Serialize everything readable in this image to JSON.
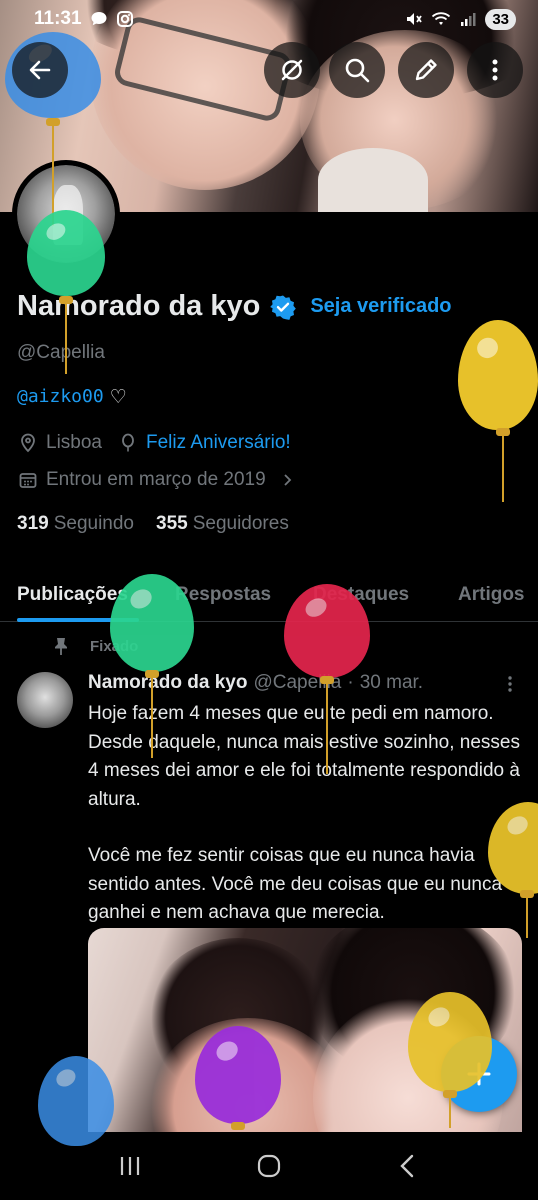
{
  "status_bar": {
    "time": "11:31",
    "battery": "33"
  },
  "header": {
    "icons": [
      "back-arrow-icon",
      "notification-off-icon",
      "search-icon",
      "edit-icon",
      "more-vertical-icon"
    ]
  },
  "profile": {
    "display_name": "Namorado da kyo",
    "get_verified_label": "Seja verificado",
    "handle": "@Capellia",
    "bio_mention": "@aizko00",
    "bio_suffix": "♡",
    "location": "Lisboa",
    "birthday": "Feliz Aniversário!",
    "joined": "Entrou em março de 2019",
    "following_count": "319",
    "following_label": "Seguindo",
    "followers_count": "355",
    "followers_label": "Seguidores"
  },
  "tabs": [
    {
      "label": "Publicações",
      "active": true
    },
    {
      "label": "Respostas",
      "active": false
    },
    {
      "label": "Destaques",
      "active": false
    },
    {
      "label": "Artigos",
      "active": false
    }
  ],
  "pinned_tweet": {
    "pinned_label": "Fixado",
    "author_name": "Namorado da kyo",
    "author_handle": "@Capellia",
    "separator": "·",
    "date": "30 mar.",
    "paragraph_1": "Hoje fazem 4 meses que eu te pedi em namoro. Desde daquele, nunca mais estive sozinho, nesses 4 meses dei amor e ele foi totalmente respondido à altura.",
    "paragraph_2": "Você me fez sentir coisas que eu nunca havia sentido antes. Você me deu coisas que eu nunca ganhei e nem achava que merecia."
  },
  "colors": {
    "accent": "#1d9bf0",
    "text_primary": "#e7e9ea",
    "text_secondary": "#71767b",
    "background": "#000000",
    "balloon_blue": "#3a8ee6",
    "balloon_green": "#2bd58f",
    "balloon_yellow": "#e7c12a",
    "balloon_red": "#e5254d",
    "balloon_purple": "#9a2fd9"
  }
}
